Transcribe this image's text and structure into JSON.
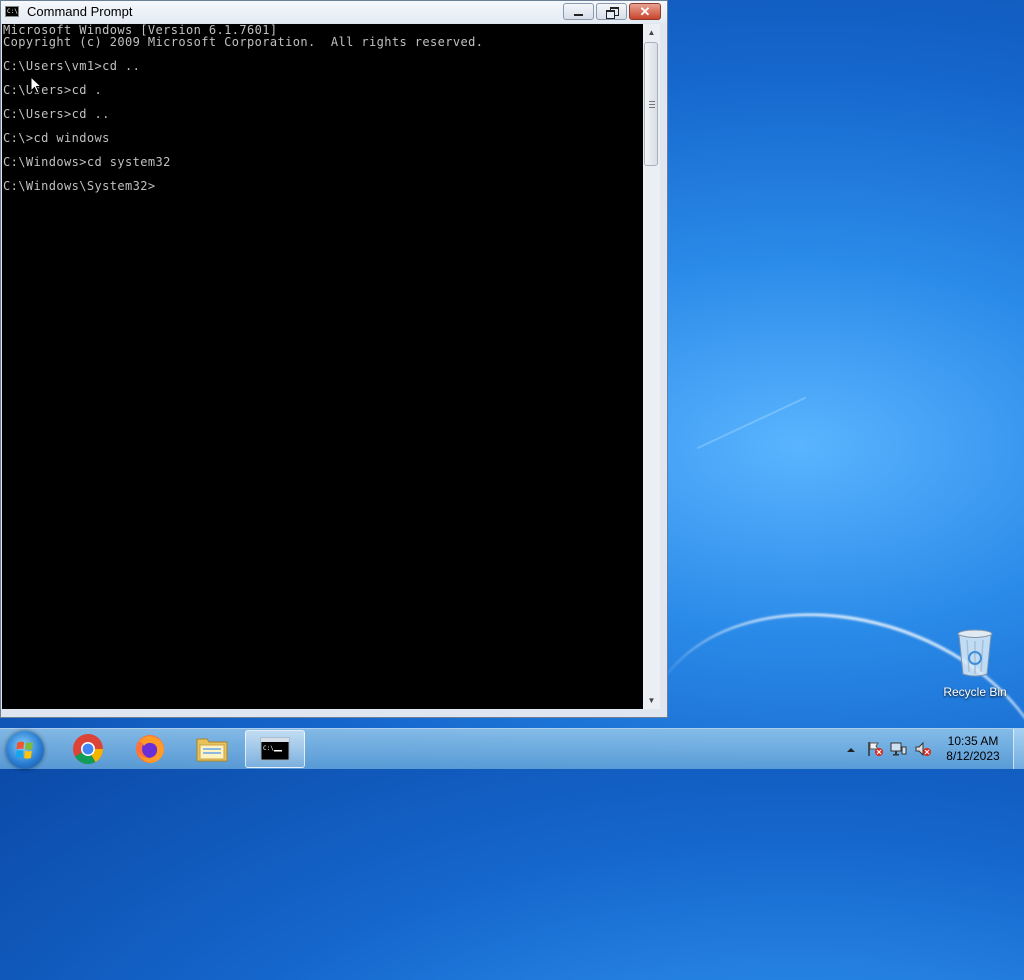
{
  "window": {
    "title": "Command Prompt",
    "icon": "cmd-icon"
  },
  "console": {
    "lines": [
      "Microsoft Windows [Version 6.1.7601]",
      "Copyright (c) 2009 Microsoft Corporation.  All rights reserved.",
      "",
      "C:\\Users\\vm1>cd ..",
      "",
      "C:\\Users>cd .",
      "",
      "C:\\Users>cd ..",
      "",
      "C:\\>cd windows",
      "",
      "C:\\Windows>cd system32",
      "",
      "C:\\Windows\\System32>"
    ]
  },
  "desktop": {
    "recycle_bin_label": "Recycle Bin"
  },
  "taskbar": {
    "pinned": [
      "chrome-icon",
      "firefox-icon",
      "file-explorer-icon",
      "cmd-icon"
    ],
    "clock_time": "10:35 AM",
    "clock_date": "8/12/2023"
  },
  "colors": {
    "console_bg": "#000000",
    "console_fg": "#c0c0c0",
    "desktop_accent": "#1566cc"
  }
}
